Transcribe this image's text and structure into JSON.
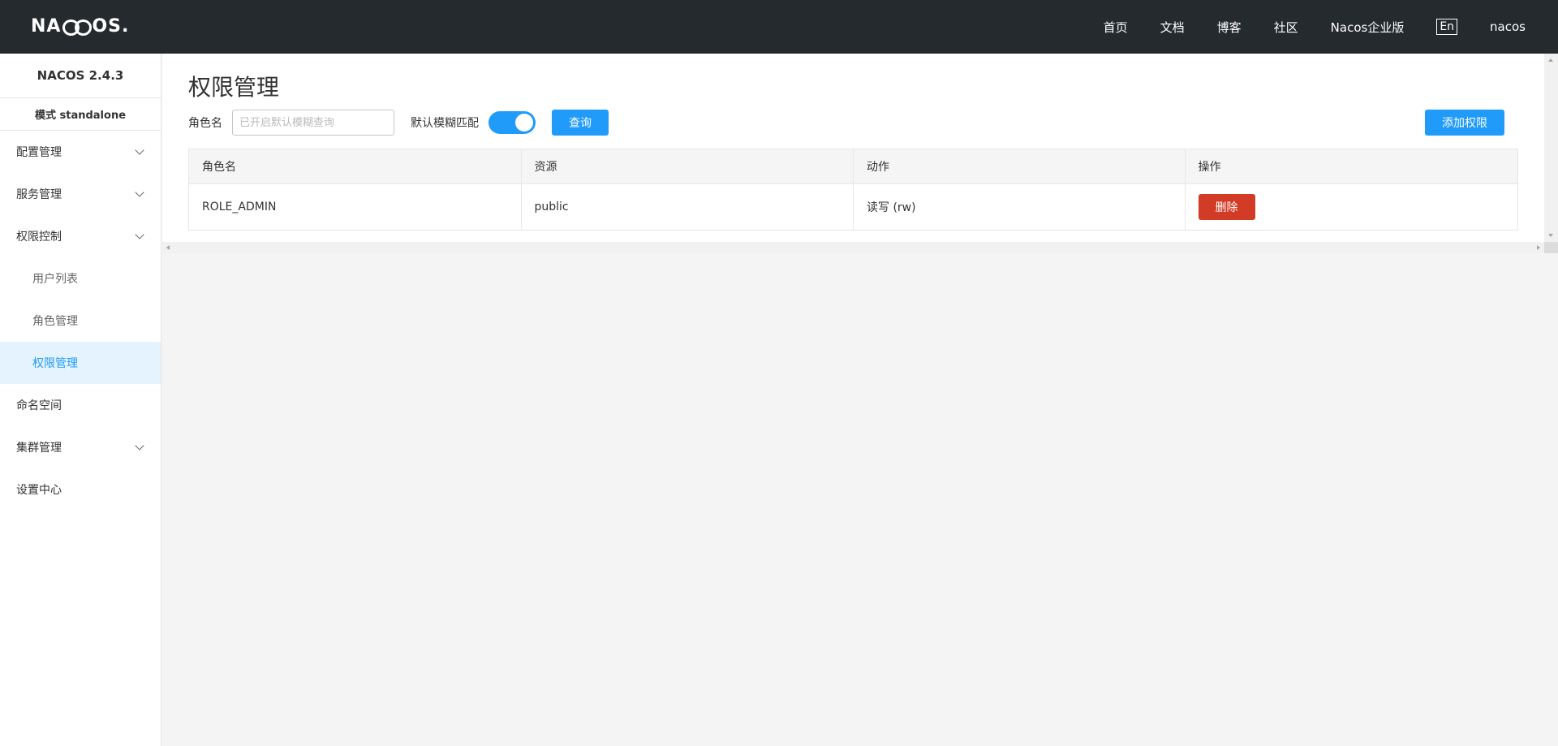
{
  "header": {
    "logo_text_left": "NA",
    "logo_text_right": "OS",
    "logo_dot": ".",
    "nav": [
      "首页",
      "文档",
      "博客",
      "社区",
      "Nacos企业版"
    ],
    "lang_button": "En",
    "username": "nacos"
  },
  "sidebar": {
    "version": "NACOS 2.4.3",
    "mode": "模式 standalone",
    "items": [
      {
        "label": "配置管理"
      },
      {
        "label": "服务管理"
      },
      {
        "label": "权限控制"
      },
      {
        "label": "用户列表"
      },
      {
        "label": "角色管理"
      },
      {
        "label": "权限管理"
      },
      {
        "label": "命名空间"
      },
      {
        "label": "集群管理"
      },
      {
        "label": "设置中心"
      }
    ]
  },
  "main": {
    "title": "权限管理",
    "filter": {
      "role_label": "角色名",
      "search_placeholder": "已开启默认模糊查询",
      "search_value": "",
      "fuzzy_label": "默认模糊匹配",
      "fuzzy_enabled": true,
      "query_button": "查询",
      "add_button": "添加权限"
    },
    "table": {
      "columns": [
        "角色名",
        "资源",
        "动作",
        "操作"
      ],
      "rows": [
        {
          "role": "ROLE_ADMIN",
          "resource": "public",
          "action": "读写 (rw)",
          "op_button": "删除"
        }
      ]
    }
  },
  "colors": {
    "header_bg": "#252a2f",
    "primary": "#209bfa",
    "danger": "#d23c26",
    "active_menu_bg": "#e5f3ff"
  }
}
